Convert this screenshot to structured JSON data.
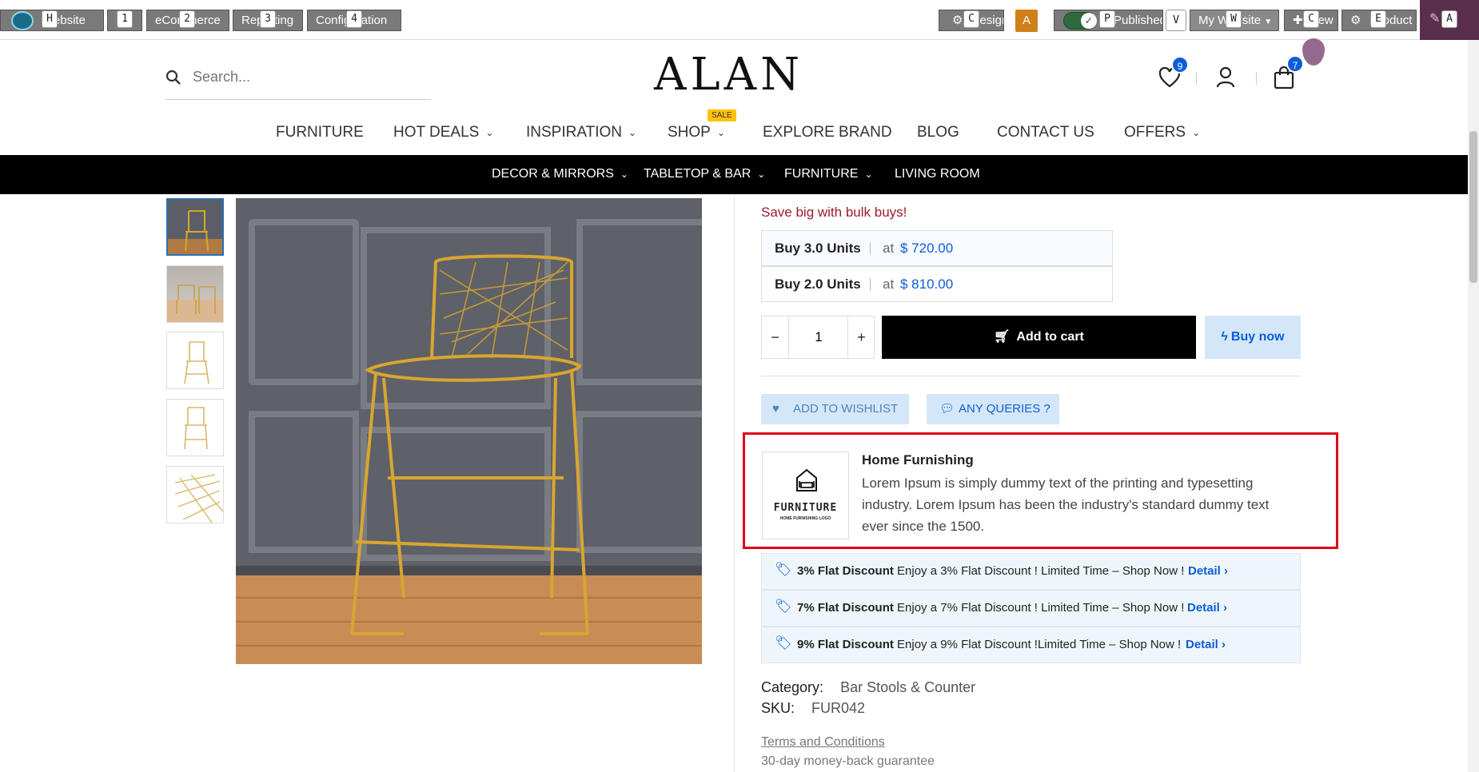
{
  "topbar": {
    "website_btn": "Website",
    "menus": [
      "eCommerce",
      "Reporting",
      "Configuration"
    ],
    "menu_hints": [
      "1",
      "2",
      "3",
      "4"
    ],
    "website_hint": "H",
    "customize_label": "Design",
    "customize_hint": "C",
    "avatar_letter": "A",
    "published_label": "Published",
    "published_hint": "P",
    "v_hint": "V",
    "website_select": "My Website",
    "website_select_hint": "W",
    "new_label": "New",
    "new_hint": "C",
    "product_label": "Product",
    "product_hint": "E",
    "edit_hint": "A"
  },
  "header": {
    "search_placeholder": "Search...",
    "logo": "ALAN",
    "wishlist_count": "9",
    "cart_count": "7"
  },
  "nav": {
    "items": [
      "FURNITURE",
      "HOT DEALS",
      "INSPIRATION",
      "SHOP",
      "EXPLORE BRAND",
      "BLOG",
      "CONTACT US",
      "OFFERS"
    ],
    "sale_tag": "SALE"
  },
  "subnav": {
    "items": [
      "DECOR & MIRRORS",
      "TABLETOP & BAR",
      "FURNITURE",
      "LIVING ROOM"
    ]
  },
  "product": {
    "bulk_title": "Save big with bulk buys!",
    "bulk": [
      {
        "units": "Buy 3.0 Units",
        "at": "at",
        "price": "$ 720.00"
      },
      {
        "units": "Buy 2.0 Units",
        "at": "at",
        "price": "$ 810.00"
      }
    ],
    "qty": "1",
    "minus": "−",
    "plus": "+",
    "add_to_cart": "Add to cart",
    "buy_now": "Buy now",
    "wishlist": "ADD TO WISHLIST",
    "queries": "ANY QUERIES ?",
    "brand": {
      "title": "Home Furnishing",
      "text": "Lorem Ipsum is simply dummy text of the printing and typesetting industry. Lorem Ipsum has been the industry's standard dummy text ever since the 1500.",
      "logo_word": "FURNITURE",
      "logo_sub": "HOME FURNISHING LOGO"
    },
    "discounts": [
      {
        "title": "3% Flat Discount",
        "text": "Enjoy a 3% Flat Discount ! Limited Time – Shop Now !",
        "link": "Detail ›"
      },
      {
        "title": "7% Flat Discount",
        "text": "Enjoy a 7% Flat Discount ! Limited Time – Shop Now !",
        "link": "Detail ›"
      },
      {
        "title": "9% Flat Discount",
        "text": "Enjoy a 9% Flat Discount !Limited Time – Shop Now !",
        "link": "Detail ›"
      }
    ],
    "category_label": "Category:",
    "category_value": "Bar Stools & Counter",
    "sku_label": "SKU:",
    "sku_value": "FUR042",
    "terms": "Terms and Conditions",
    "guarantee": "30-day money-back guarantee"
  },
  "colors": {
    "accent_blue": "#0b5ed7",
    "bulk_red": "#9b1c2c",
    "highlight_red": "#e0001b",
    "light_blue_btn": "#d4e7f8"
  }
}
